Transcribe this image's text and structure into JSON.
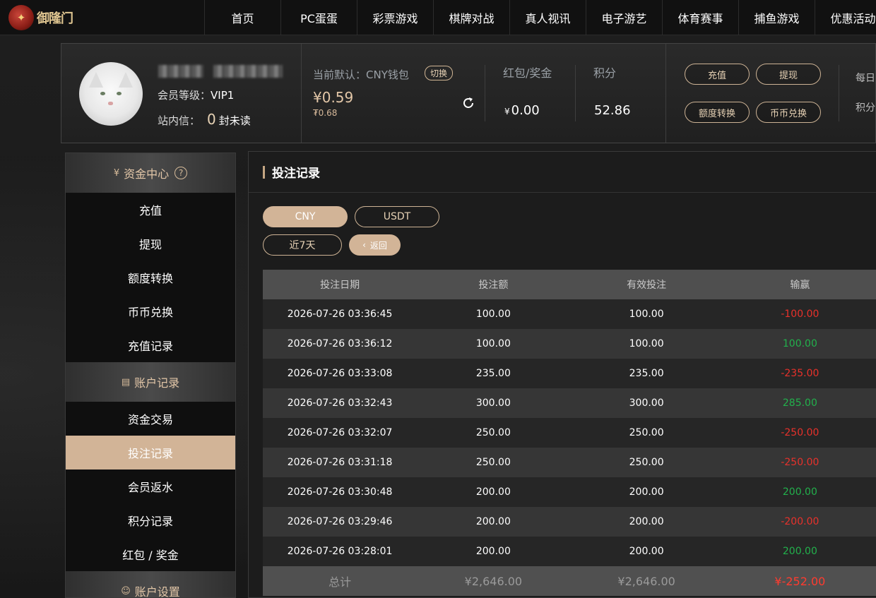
{
  "nav": {
    "logo_text": "御隆门",
    "items": [
      "首页",
      "PC蛋蛋",
      "彩票游戏",
      "棋牌对战",
      "真人视讯",
      "电子游艺",
      "体育赛事",
      "捕鱼游戏",
      "优惠活动"
    ]
  },
  "account": {
    "level_label": "会员等级：",
    "level_value": "VIP1",
    "message_label": "站内信：",
    "message_count": "0",
    "message_unread": "封未读",
    "wallet_label": "当前默认：CNY钱包",
    "switch_label": "切换",
    "balance": "¥0.59",
    "balance_sub": "₮0.68",
    "bonus_label": "红包/奖金",
    "bonus_currency": "¥",
    "bonus_value": "0.00",
    "points_label": "积分",
    "points_value": "52.86",
    "buttons": {
      "recharge": "充值",
      "withdraw": "提现",
      "transfer": "额度转换",
      "exchange": "币币兑换"
    },
    "right_labels": [
      "每日",
      "积分"
    ]
  },
  "sidebar": {
    "sections": [
      {
        "title": "资金中心",
        "items": [
          "充值",
          "提现",
          "额度转换",
          "币币兑换",
          "充值记录"
        ]
      },
      {
        "title": "账户记录",
        "items": [
          "资金交易",
          "投注记录",
          "会员返水",
          "积分记录",
          "红包 / 奖金"
        ]
      },
      {
        "title": "账户设置",
        "items": []
      }
    ],
    "active_item": "投注记录"
  },
  "panel": {
    "title": "投注记录",
    "currency_chips": [
      "CNY",
      "USDT"
    ],
    "selected_currency": "CNY",
    "period_label": "近7天",
    "back_label": "返回",
    "back_icon": "‹"
  },
  "table": {
    "headers": [
      "投注日期",
      "投注额",
      "有效投注",
      "输赢"
    ],
    "rows": [
      [
        "2026-07-26 03:36:45",
        "100.00",
        "100.00",
        "-100.00"
      ],
      [
        "2026-07-26 03:36:12",
        "100.00",
        "100.00",
        "100.00"
      ],
      [
        "2026-07-26 03:33:08",
        "235.00",
        "235.00",
        "-235.00"
      ],
      [
        "2026-07-26 03:32:43",
        "300.00",
        "300.00",
        "285.00"
      ],
      [
        "2026-07-26 03:32:07",
        "250.00",
        "250.00",
        "-250.00"
      ],
      [
        "2026-07-26 03:31:18",
        "250.00",
        "250.00",
        "-250.00"
      ],
      [
        "2026-07-26 03:30:48",
        "200.00",
        "200.00",
        "200.00"
      ],
      [
        "2026-07-26 03:29:46",
        "200.00",
        "200.00",
        "-200.00"
      ],
      [
        "2026-07-26 03:28:01",
        "200.00",
        "200.00",
        "200.00"
      ]
    ],
    "footer": [
      "总计",
      "¥2,646.00",
      "¥2,646.00",
      "¥-252.00"
    ]
  },
  "colors": {
    "accent": "#d2b497",
    "loss": "#e8312b",
    "win": "#22b14c"
  }
}
